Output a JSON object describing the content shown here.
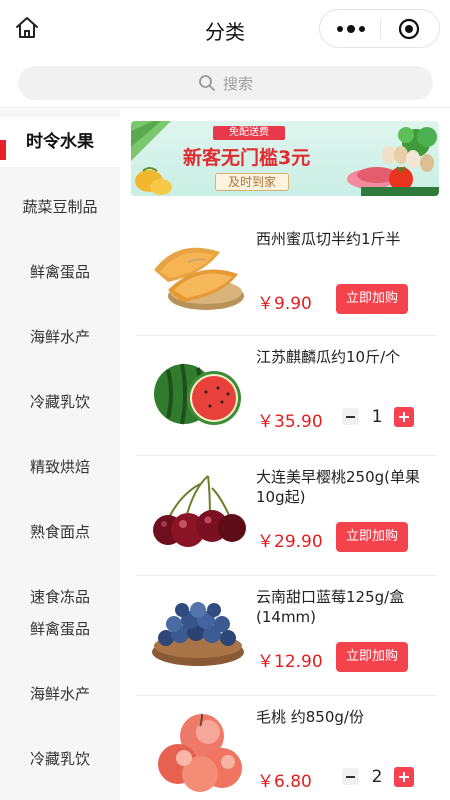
{
  "header": {
    "title": "分类",
    "home_icon": "home-icon",
    "more_icon": "more-dots-icon",
    "target_icon": "record-target-icon"
  },
  "search": {
    "placeholder": "搜索",
    "icon": "search-icon"
  },
  "sidebar": {
    "items": [
      {
        "label": "时令水果",
        "active": true
      },
      {
        "label": "蔬菜豆制品"
      },
      {
        "label": "鲜禽蛋品"
      },
      {
        "label": "海鲜水产"
      },
      {
        "label": "冷藏乳饮"
      },
      {
        "label": "精致烘焙"
      },
      {
        "label": "熟食面点"
      },
      {
        "label": "速食冻品"
      },
      {
        "label": "鲜禽蛋品"
      },
      {
        "label": "海鲜水产"
      },
      {
        "label": "冷藏乳饮"
      }
    ]
  },
  "banner": {
    "tag": "免配送费",
    "headline": "新客无门槛3元",
    "sub": "及时到家"
  },
  "products": [
    {
      "name": "西州蜜瓜切半约1斤半",
      "price": "￥9.90",
      "action": "立即加购"
    },
    {
      "name": "江苏麒麟瓜约10斤/个",
      "price": "￥35.90",
      "qty": "1"
    },
    {
      "name": "大连美早樱桃250g(单果10g起)",
      "price": "￥29.90",
      "action": "立即加购"
    },
    {
      "name": "云南甜口蓝莓125g/盒(14mm)",
      "price": "￥12.90",
      "action": "立即加购"
    },
    {
      "name": "毛桃 约850g/份",
      "price": "￥6.80",
      "qty": "2"
    }
  ],
  "colors": {
    "accent": "#f4434d",
    "price": "#e02020",
    "sidebar_bg": "#f6f6f6"
  }
}
